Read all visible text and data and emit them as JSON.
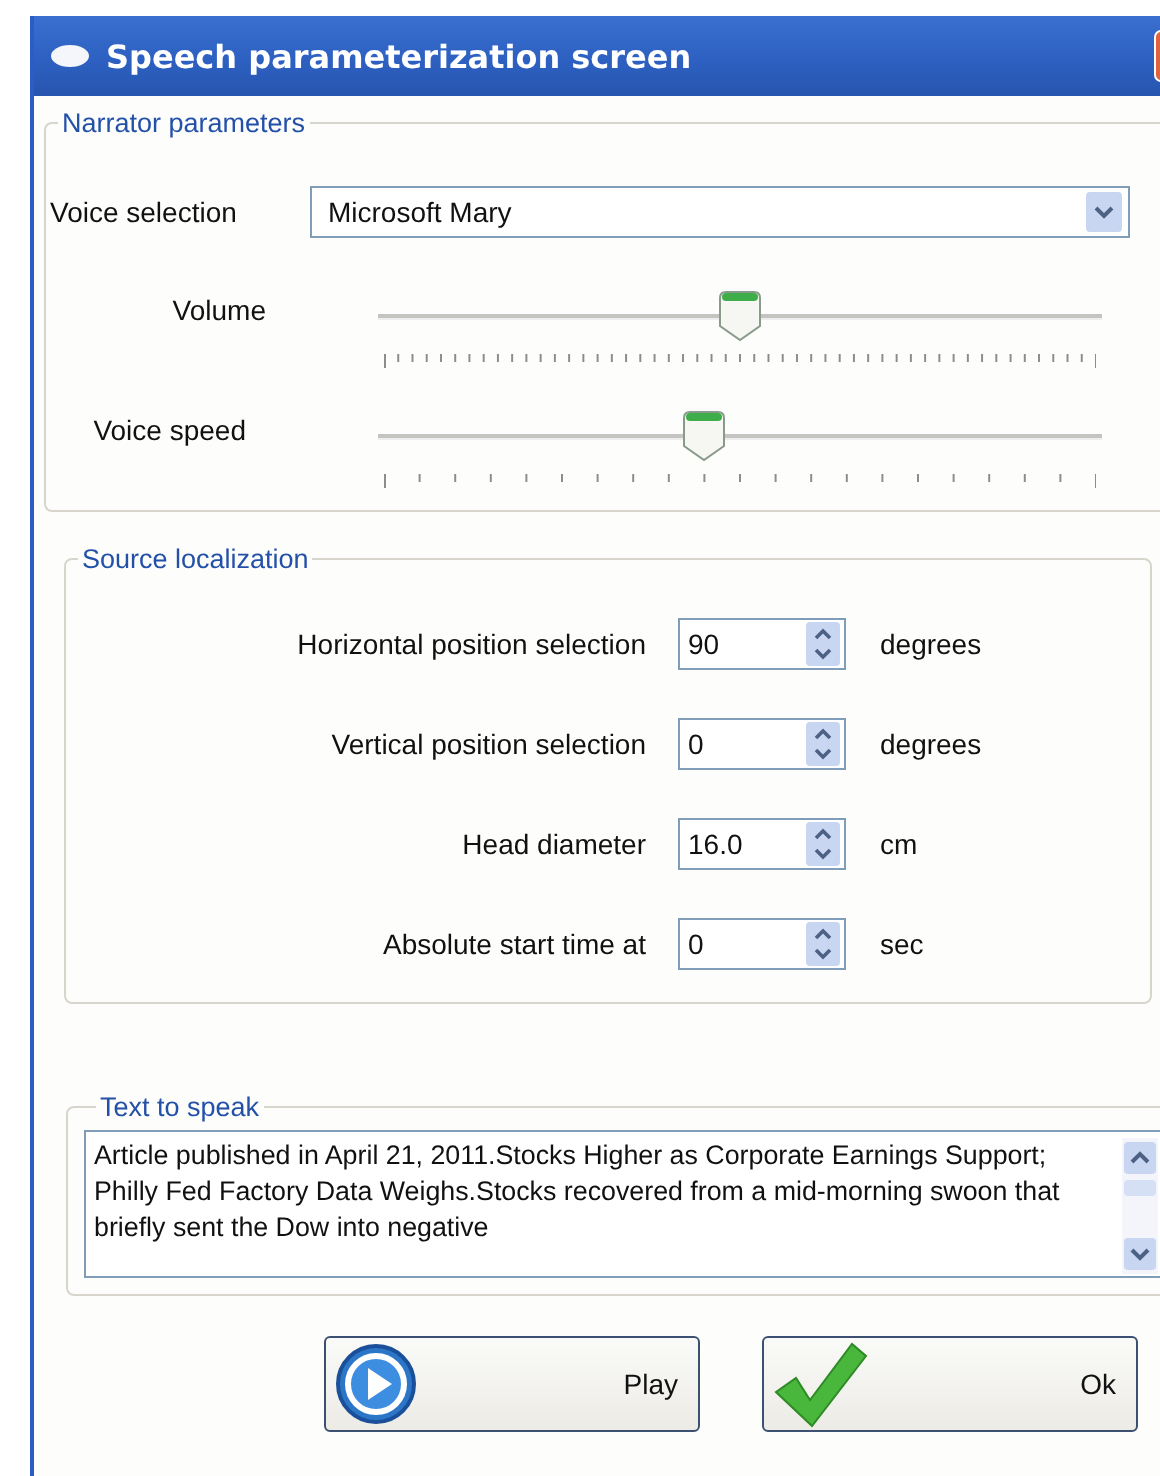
{
  "window": {
    "title": "Speech parameterization screen"
  },
  "narrator": {
    "legend": "Narrator parameters",
    "voice": {
      "label": "Voice selection",
      "value": "Microsoft Mary"
    },
    "sliders": [
      {
        "label": "Volume",
        "level": 0.5
      },
      {
        "label": "Voice speed",
        "level": 0.45
      }
    ]
  },
  "source": {
    "legend": "Source localization",
    "fields": [
      {
        "label": "Horizontal position selection",
        "value": "90",
        "unit": "degrees"
      },
      {
        "label": "Vertical position selection",
        "value": "0",
        "unit": "degrees"
      },
      {
        "label": "Head diameter",
        "value": "16.0",
        "unit": "cm"
      },
      {
        "label": "Absolute start time at",
        "value": "0",
        "unit": "sec"
      }
    ]
  },
  "text_to_speak": {
    "legend": "Text to speak",
    "text": "Article published in April 21, 2011.Stocks Higher as Corporate Earnings Support; Philly Fed Factory Data Weighs.Stocks recovered from a mid-morning swoon that briefly sent the Dow into negative"
  },
  "buttons": [
    {
      "label": "Play",
      "kind": "play"
    },
    {
      "label": "Ok",
      "kind": "ok"
    }
  ]
}
